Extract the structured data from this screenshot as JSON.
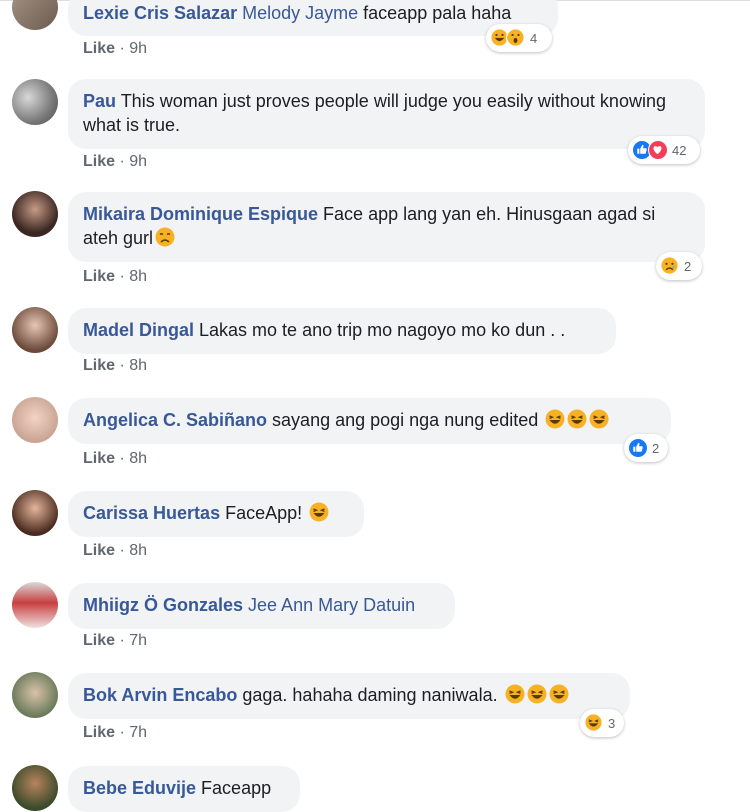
{
  "comments": [
    {
      "author": "Lexie Cris Salazar",
      "tagged": "Melody Jayme",
      "text": " faceapp pala haha",
      "emoji_count": 0,
      "like": "Like",
      "time": "9h",
      "reaction_icons": [
        "haha",
        "wow"
      ],
      "reaction_count": "4"
    },
    {
      "author": "Pau",
      "tagged": "",
      "text": " This woman just proves people will judge you easily without knowing what is true.",
      "emoji_count": 0,
      "like": "Like",
      "time": "9h",
      "reaction_icons": [
        "like",
        "love"
      ],
      "reaction_count": "42"
    },
    {
      "author": "Mikaira Dominique Espique",
      "tagged": "",
      "text": " Face app lang yan eh. Hinusgaan agad si ateh gurl",
      "emoji_count": 1,
      "like": "Like",
      "time": "8h",
      "reaction_icons": [
        "sad"
      ],
      "reaction_count": "2"
    },
    {
      "author": "Madel Dingal",
      "tagged": "",
      "text": " Lakas mo te ano trip mo nagoyo mo ko dun . .",
      "emoji_count": 0,
      "like": "Like",
      "time": "8h",
      "reaction_icons": [],
      "reaction_count": ""
    },
    {
      "author": "Angelica C. Sabiñano",
      "tagged": "",
      "text": " sayang ang pogi nga nung edited",
      "emoji_count": 3,
      "like": "Like",
      "time": "8h",
      "reaction_icons": [
        "like"
      ],
      "reaction_count": "2"
    },
    {
      "author": "Carissa Huertas",
      "tagged": "",
      "text": " FaceApp!",
      "emoji_count": 1,
      "like": "Like",
      "time": "8h",
      "reaction_icons": [],
      "reaction_count": ""
    },
    {
      "author": "Mhiigz Ö Gonzales",
      "tagged": "Jee Ann Mary Datuin",
      "text": "",
      "emoji_count": 0,
      "like": "Like",
      "time": "7h",
      "reaction_icons": [],
      "reaction_count": ""
    },
    {
      "author": "Bok Arvin Encabo",
      "tagged": "",
      "text": " gaga. hahaha daming naniwala.",
      "emoji_count": 3,
      "like": "Like",
      "time": "7h",
      "reaction_icons": [
        "haha"
      ],
      "reaction_count": "3"
    },
    {
      "author": "Bebe Eduvije",
      "tagged": "",
      "text": " Faceapp",
      "emoji_count": 0,
      "like": "",
      "time": "",
      "reaction_icons": [],
      "reaction_count": ""
    }
  ],
  "colors": {
    "name": "#385898",
    "bubble": "#f2f3f5",
    "like": "#1877f2",
    "love": "#f33e58",
    "haha": "#f7b125"
  }
}
